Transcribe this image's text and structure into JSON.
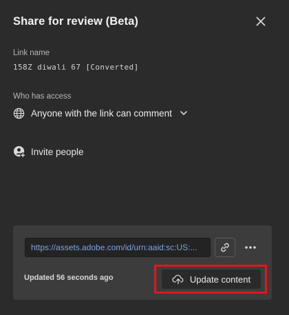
{
  "dialog": {
    "title": "Share for review (Beta)",
    "close_icon": "close-icon"
  },
  "link_name": {
    "label": "Link name",
    "value": "158Z diwali 67 [Converted]"
  },
  "access": {
    "label": "Who has access",
    "value": "Anyone with the link can comment",
    "icon": "globe-icon",
    "chevron_icon": "chevron-down-icon"
  },
  "invite": {
    "label": "Invite people",
    "icon": "add-person-icon"
  },
  "footer": {
    "url": "https://assets.adobe.com/id/urn:aaid:sc:US:...",
    "copy_icon": "link-icon",
    "more_icon": "more-icon",
    "updated_text": "Updated 56 seconds ago",
    "update_button_label": "Update content",
    "update_icon": "cloud-upload-icon",
    "highlight_color": "#e3161e"
  }
}
